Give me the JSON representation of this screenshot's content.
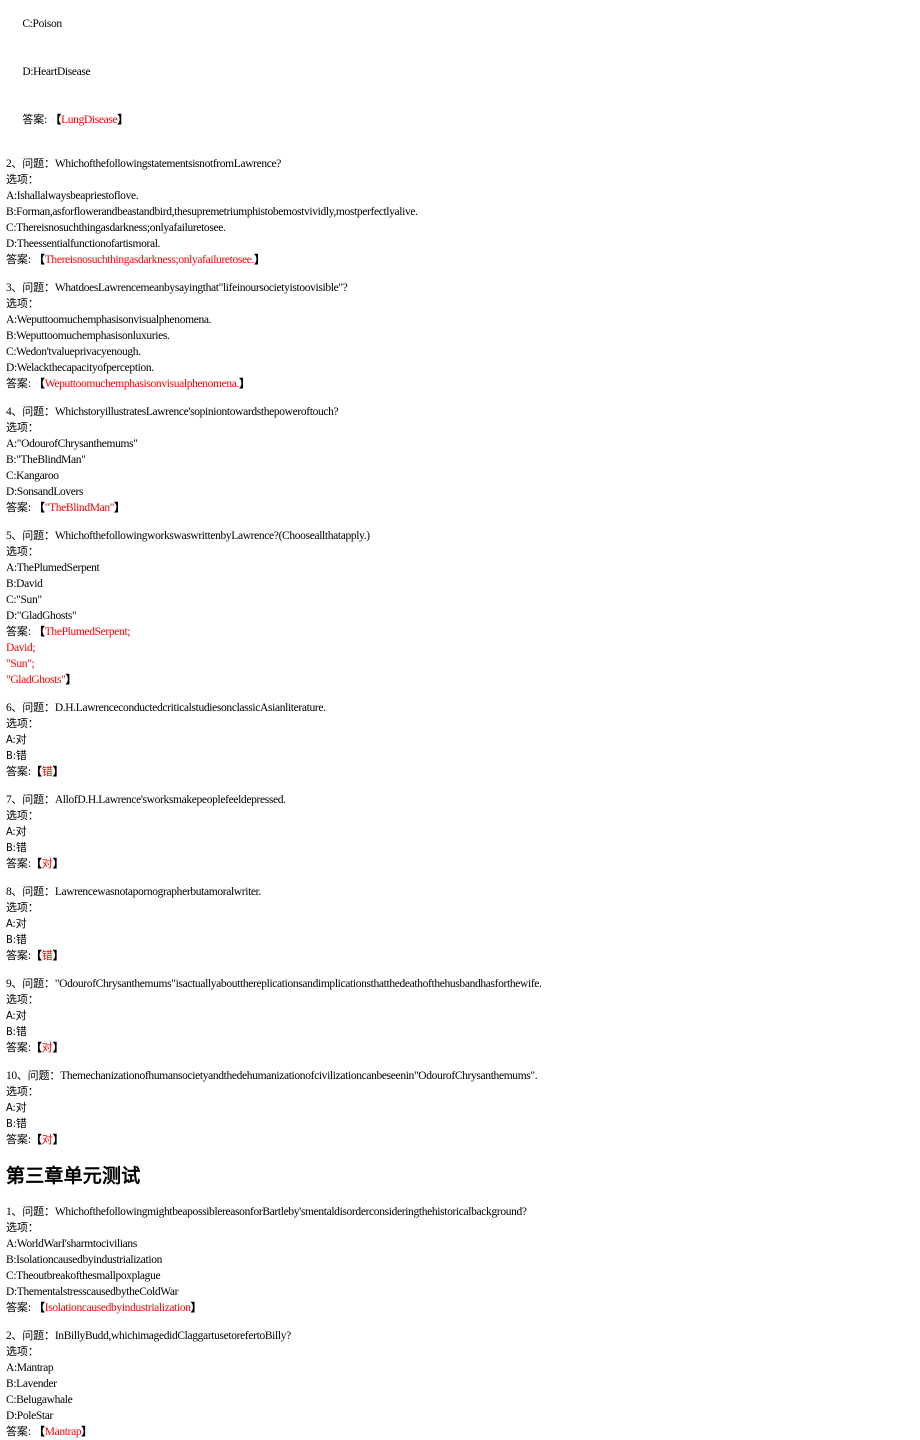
{
  "document": {
    "answer_color": "#ff0000",
    "text_color": "#000000",
    "background": "#ffffff",
    "labels": {
      "question_prefix": "、问题：",
      "options_label": "选项：",
      "answer_label_spaced": "答案: ",
      "answer_label_tight": "答案:",
      "bracket_open": "【",
      "bracket_close": "】"
    }
  },
  "partial_block": {
    "options": [
      "C:Poison",
      "D:HeartDisease"
    ],
    "answer_label": "答案: ",
    "answer": "LungDisease"
  },
  "chapter_heading": "第三章单元测试",
  "chapter2_questions": [
    {
      "number": "2",
      "prefix": "、问题：",
      "stem": "Whichofthefollowingstatementsisnotfromlawrence?",
      "stem_display": "Whichofthefollowingstatementsisnotfromlawrence?",
      "stem_actual": "WhichofthefollowingstatementsisnotfromLawrence?",
      "options_label": "选项：",
      "options": [
        "A:Ishallalwaysbeapriestoflove.",
        "B:Forman,asforflowerandbeastandbird,thesupremetriumphistobemostvividly,mostperfectlyalive.",
        "C:Thereisnosuchthingasdarkness;onlyafailuretosee.",
        "D:Theessentialfunctionofartismoral."
      ],
      "answer_label": "答案: ",
      "answer_lines": [
        "Thereisnosuchthingasdarkness;onlyafailuretosee."
      ],
      "answer_is_cn": false
    },
    {
      "number": "3",
      "prefix": "、问题：",
      "stem_actual": "WhatdoesLawrencemeanbysayingthat\"lifeinoursocietyistoovisible\"?",
      "options_label": "选项：",
      "options": [
        "A:Weputtoomuchemphasisonvisualphenomena.",
        "B:Weputtoomuchemphasisonluxuries.",
        "C:Wedon'tvalueprivacyenough.",
        "D:Welackthecapacityofperception."
      ],
      "answer_label": "答案: ",
      "answer_lines": [
        "Weputtoomuchemphasisonvisualphenomena."
      ],
      "answer_is_cn": false
    },
    {
      "number": "4",
      "prefix": "、问题：",
      "stem_actual": "WhichstoryillustratesLawrence'sopiniontowardsthepoweroftouch?",
      "options_label": "选项：",
      "options": [
        "A:\"OdourofChrysanthemums\"",
        "B:\"TheBlindMan\"",
        "C:Kangaroo",
        "D:SonsandLovers"
      ],
      "answer_label": "答案: ",
      "answer_lines": [
        "\"TheBlindMan\""
      ],
      "answer_is_cn": false
    },
    {
      "number": "5",
      "prefix": "、问题：",
      "stem_actual": "WhichofthefollowingworkswaswrittenbyLawrence?(Chooseallthatapply.)",
      "options_label": "选项：",
      "options": [
        "A:ThePlumedSerpent",
        "B:David",
        "C:\"Sun\"",
        "D:\"GladGhosts\""
      ],
      "answer_label": "答案: ",
      "answer_lines": [
        "ThePlumedSerpent;",
        "David;",
        "\"Sun\";",
        "\"GladGhosts\""
      ],
      "answer_is_cn": false
    },
    {
      "number": "6",
      "prefix": "、问题：",
      "stem_actual": "D.H.LawrenceconductedcriticalstudiesonclassicAsianliterature.",
      "options_label": "选项：",
      "options": [
        "A:对",
        "B:错"
      ],
      "answer_label": "答案:",
      "answer_lines": [
        "错"
      ],
      "answer_is_cn": true
    },
    {
      "number": "7",
      "prefix": "、问题：",
      "stem_actual": "AllofD.H.Lawrence'sworksmakepeoplefeeldepressed.",
      "options_label": "选项：",
      "options": [
        "A:对",
        "B:错"
      ],
      "answer_label": "答案:",
      "answer_lines": [
        "对"
      ],
      "answer_is_cn": true
    },
    {
      "number": "8",
      "prefix": "、问题：",
      "stem_actual": "Lawrencewasnotapornographerbutamoralwriter.",
      "options_label": "选项：",
      "options": [
        "A:对",
        "B:错"
      ],
      "answer_label": "答案:",
      "answer_lines": [
        "错"
      ],
      "answer_is_cn": true
    },
    {
      "number": "9",
      "prefix": "、问题：",
      "stem_actual": "\"OdourofChrysanthemums\"isactuallyaboutthereplicationsandimplicationsthatthedeathofthehusbandhasforthewife.",
      "options_label": "选项：",
      "options": [
        "A:对",
        "B:错"
      ],
      "answer_label": "答案:",
      "answer_lines": [
        "对"
      ],
      "answer_is_cn": true
    },
    {
      "number": "10",
      "prefix": "、问题：",
      "stem_actual": "Themechanizationofhumansocietyandthedehumanizationofcivilizationcanbeseenin\"OdourofChrysanthemums\".",
      "options_label": "选项：",
      "options": [
        "A:对",
        "B:错"
      ],
      "answer_label": "答案:",
      "answer_lines": [
        "对"
      ],
      "answer_is_cn": true
    }
  ],
  "chapter3_questions": [
    {
      "number": "1",
      "prefix": "、问题：",
      "stem_actual": "WhichofthefollowingmightbeapossiblereasonforBartleby'smentaldisorderconsideringthehistoricalbackground?",
      "options_label": "选项：",
      "options": [
        "A:WorldWarI'sharmtocivilians",
        "B:Isolationcausedbyindustrialization",
        "C:Theoutbreakofthesmallpoxplague",
        "D:ThementalstresscausedbytheColdWar"
      ],
      "answer_label": "答案: ",
      "answer_lines": [
        "Isolationcausedbyindustrialization"
      ],
      "answer_is_cn": false
    },
    {
      "number": "2",
      "prefix": "、问题：",
      "stem_actual": "InBillyBudd,whichimagedidClaggartusetorefertoBilly?",
      "options_label": "选项：",
      "options": [
        "A:Mantrap",
        "B:Lavender",
        "C:Belugawhale",
        "D:PoleStar"
      ],
      "answer_label": "答案: ",
      "answer_lines": [
        "Mantrap"
      ],
      "answer_is_cn": false
    }
  ]
}
